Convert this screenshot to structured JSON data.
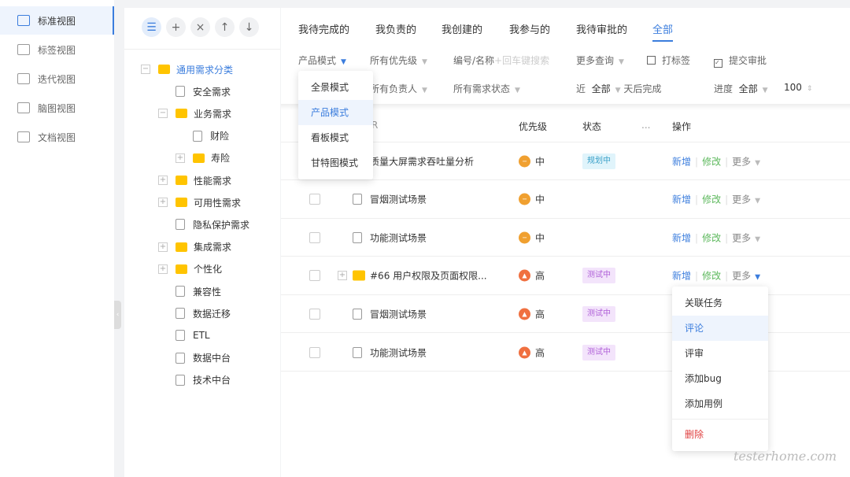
{
  "nav": {
    "items": [
      {
        "label": "标准视图",
        "icon": "standard-view-icon",
        "active": true
      },
      {
        "label": "标签视图",
        "icon": "tag-icon"
      },
      {
        "label": "迭代视图",
        "icon": "iteration-icon"
      },
      {
        "label": "脑图视图",
        "icon": "mindmap-icon"
      },
      {
        "label": "文档视图",
        "icon": "document-icon"
      }
    ]
  },
  "tree": {
    "toolbar": [
      {
        "glyph": "☰",
        "name": "list-icon",
        "on": true
      },
      {
        "glyph": "+",
        "name": "plus-icon"
      },
      {
        "glyph": "×",
        "name": "close-icon"
      },
      {
        "glyph": "↑",
        "name": "arrow-up-icon"
      },
      {
        "glyph": "↓",
        "name": "arrow-down-icon"
      }
    ],
    "nodes": [
      {
        "label": "通用需求分类",
        "level": 0,
        "type": "folder",
        "toggle": "−",
        "selected": true
      },
      {
        "label": "安全需求",
        "level": 1,
        "type": "doc"
      },
      {
        "label": "业务需求",
        "level": 1,
        "type": "folder",
        "toggle": "−"
      },
      {
        "label": "财险",
        "level": 2,
        "type": "doc"
      },
      {
        "label": "寿险",
        "level": 2,
        "type": "folder",
        "toggle": "+"
      },
      {
        "label": "性能需求",
        "level": 1,
        "type": "folder",
        "toggle": "+"
      },
      {
        "label": "可用性需求",
        "level": 1,
        "type": "folder",
        "toggle": "+"
      },
      {
        "label": "隐私保护需求",
        "level": 1,
        "type": "doc"
      },
      {
        "label": "集成需求",
        "level": 1,
        "type": "folder",
        "toggle": "+"
      },
      {
        "label": "个性化",
        "level": 1,
        "type": "folder",
        "toggle": "+"
      },
      {
        "label": "兼容性",
        "level": 1,
        "type": "doc"
      },
      {
        "label": "数据迁移",
        "level": 1,
        "type": "doc"
      },
      {
        "label": "ETL",
        "level": 1,
        "type": "doc"
      },
      {
        "label": "数据中台",
        "level": 1,
        "type": "doc"
      },
      {
        "label": "技术中台",
        "level": 1,
        "type": "doc"
      }
    ]
  },
  "tabs": [
    {
      "label": "我待完成的"
    },
    {
      "label": "我负责的"
    },
    {
      "label": "我创建的"
    },
    {
      "label": "我参与的"
    },
    {
      "label": "我待审批的"
    },
    {
      "label": "全部",
      "active": true
    }
  ],
  "filters": {
    "mode": "产品模式",
    "priority": "所有优先级",
    "search_label": "编号/名称",
    "search_placeholder": "+回车键搜索",
    "more_query": "更多查询",
    "tag": "打标签",
    "submit": "提交审批",
    "owner": "所有负责人",
    "status": "所有需求状态",
    "near": "近",
    "near_value": "全部",
    "after": "天后完成",
    "progress": "进度",
    "progress_value": "全部",
    "page_size": "100"
  },
  "mode_menu": {
    "items": [
      "全景模式",
      "产品模式",
      "看板模式",
      "甘特图模式"
    ],
    "selected": 1
  },
  "table": {
    "headers": {
      "name": "R",
      "priority": "优先级",
      "status": "状态",
      "ellipsis": "...",
      "ops": "操作"
    },
    "rows": [
      {
        "name": "质量大屏需求吞吐量分析",
        "icon": "none",
        "priority": "中",
        "status": "规划中"
      },
      {
        "name": "冒烟测试场景",
        "icon": "doc",
        "priority": "中",
        "status": ""
      },
      {
        "name": "功能测试场景",
        "icon": "doc",
        "priority": "中",
        "status": ""
      },
      {
        "name": "#66 用户权限及页面权限...",
        "icon": "folder",
        "priority": "高",
        "status": "测试中"
      },
      {
        "name": "冒烟测试场景",
        "icon": "doc",
        "priority": "高",
        "status": "测试中"
      },
      {
        "name": "功能测试场景",
        "icon": "doc",
        "priority": "高",
        "status": "测试中"
      }
    ],
    "ops": {
      "add": "新增",
      "edit": "修改",
      "more": "更多"
    }
  },
  "more_menu": {
    "items": [
      "关联任务",
      "评论",
      "评审",
      "添加bug",
      "添加用例"
    ],
    "selected": 1,
    "danger": "删除"
  },
  "watermark": "testerhome.com",
  "colors": {
    "accent": "#3b7ddd",
    "mid": "#f0a030",
    "high": "#f07040",
    "planning_bg": "#e0f4fb",
    "planning_fg": "#3aa0c8",
    "testing_bg": "#f3e4fb",
    "testing_fg": "#b060d8",
    "danger": "#e04040",
    "edit": "#5cb85c"
  }
}
